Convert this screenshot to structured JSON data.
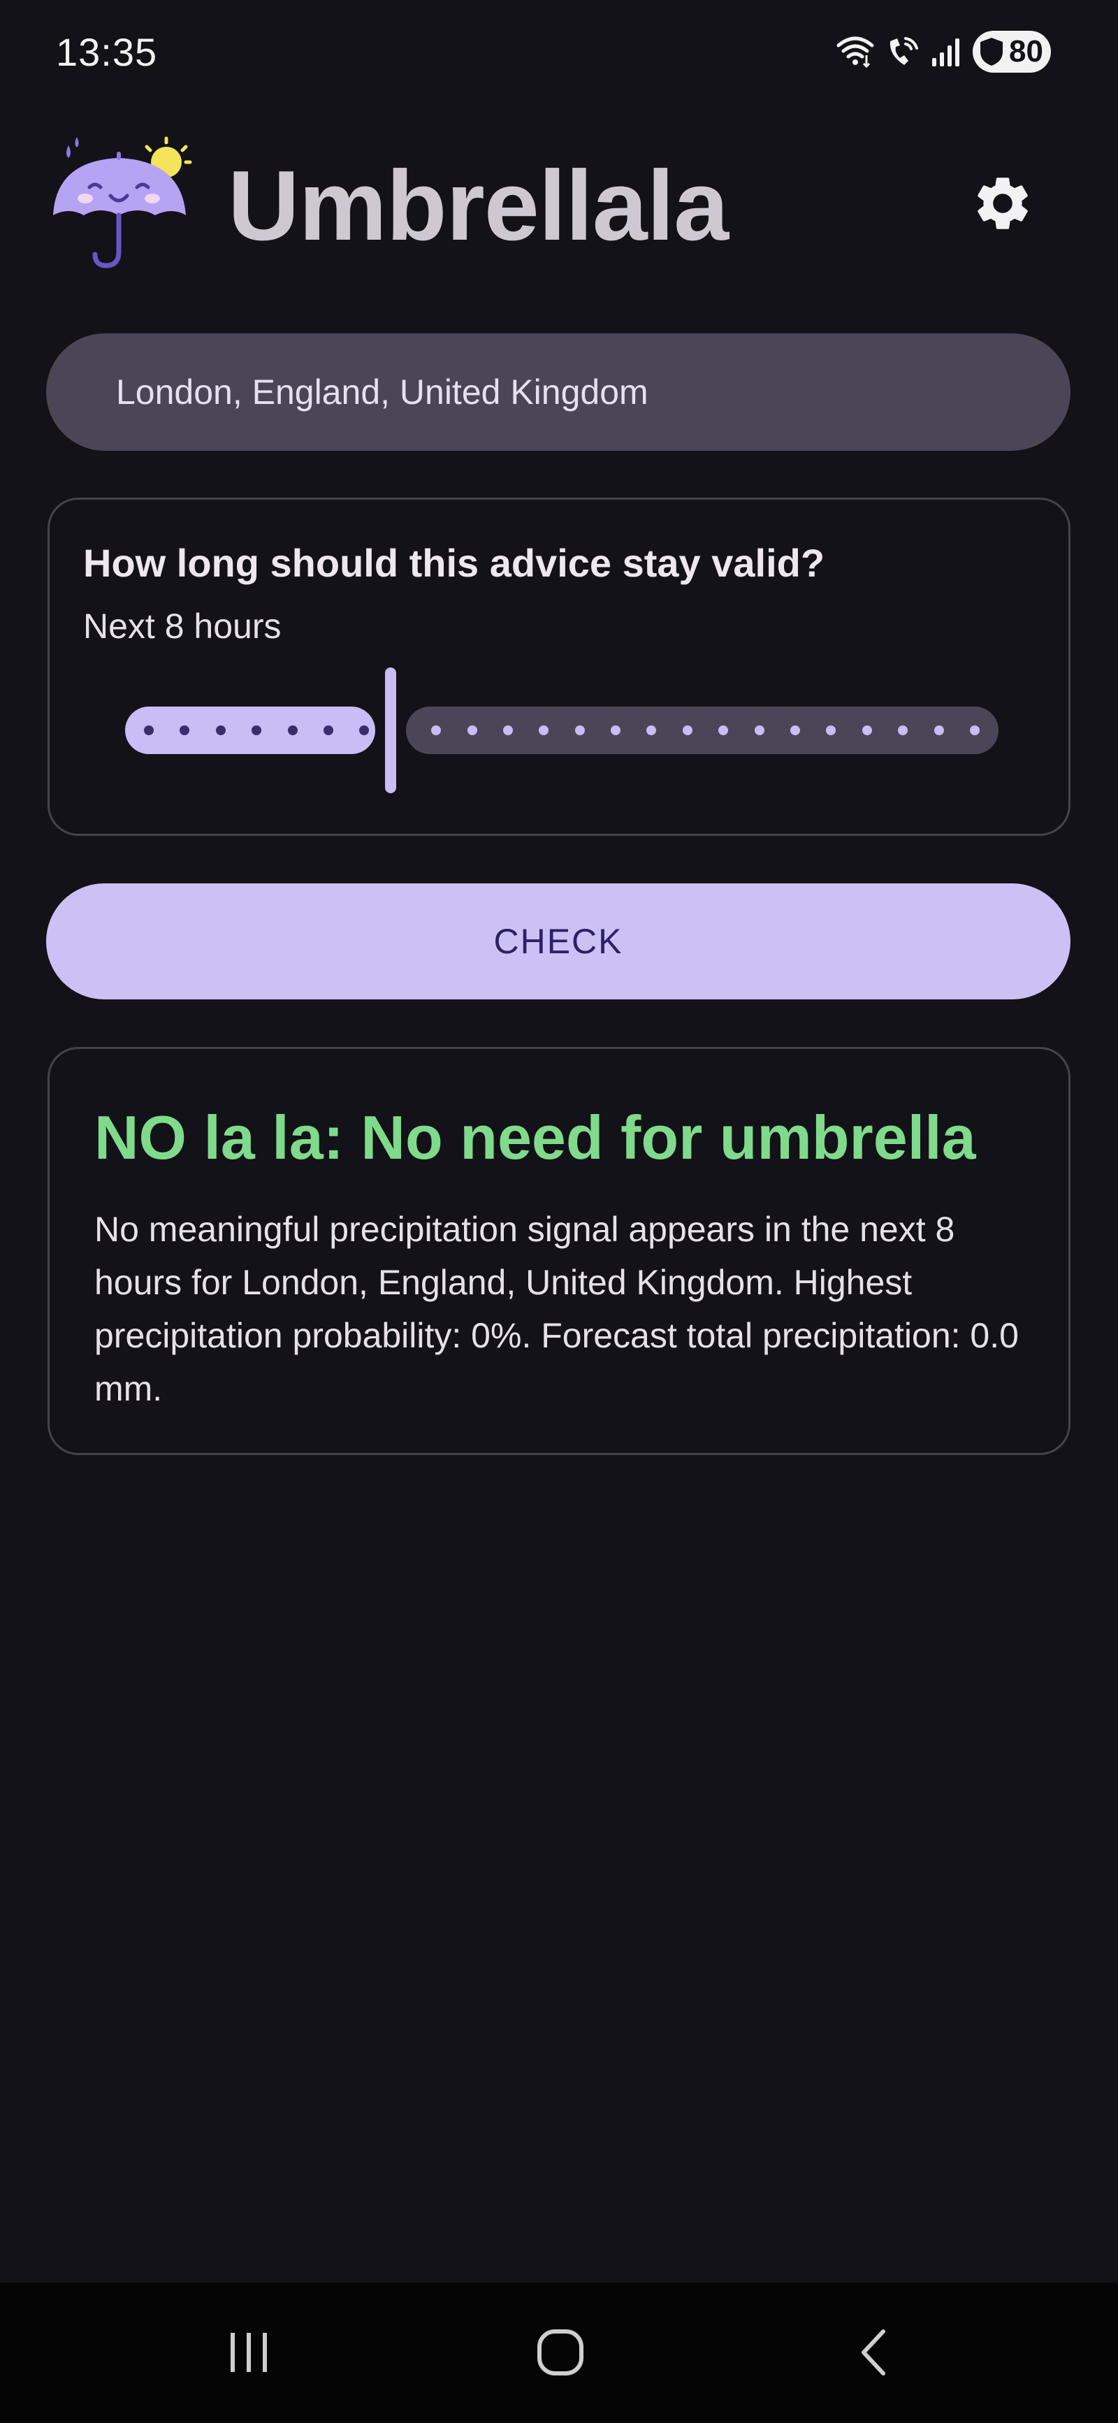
{
  "status_bar": {
    "time": "13:35",
    "battery": "80",
    "icons": [
      "wifi-icon",
      "wifi-call-icon",
      "signal-icon",
      "shield-icon"
    ]
  },
  "header": {
    "title": "Umbrellala",
    "logo_icon": "umbrella-mascot-icon",
    "settings_icon": "gear-icon"
  },
  "location": {
    "value": "London, England, United Kingdom"
  },
  "duration": {
    "question": "How long should this advice stay valid?",
    "selected_label": "Next 8 hours",
    "slider": {
      "min": 1,
      "max": 24,
      "value": 8
    }
  },
  "check_button": {
    "label": "CHECK"
  },
  "result": {
    "title": "NO la la: No need for umbrella",
    "body": "No meaningful precipitation signal appears in the next 8 hours for London, England, United Kingdom. Highest precipitation probability: 0%. Forecast total precipitation: 0.0 mm."
  },
  "colors": {
    "background": "#131218",
    "accent": "#c8bdf4",
    "field": "#4a4658",
    "success": "#7fdb8b"
  },
  "nav_bar": {
    "icons": [
      "recents-icon",
      "home-icon",
      "back-icon"
    ]
  }
}
